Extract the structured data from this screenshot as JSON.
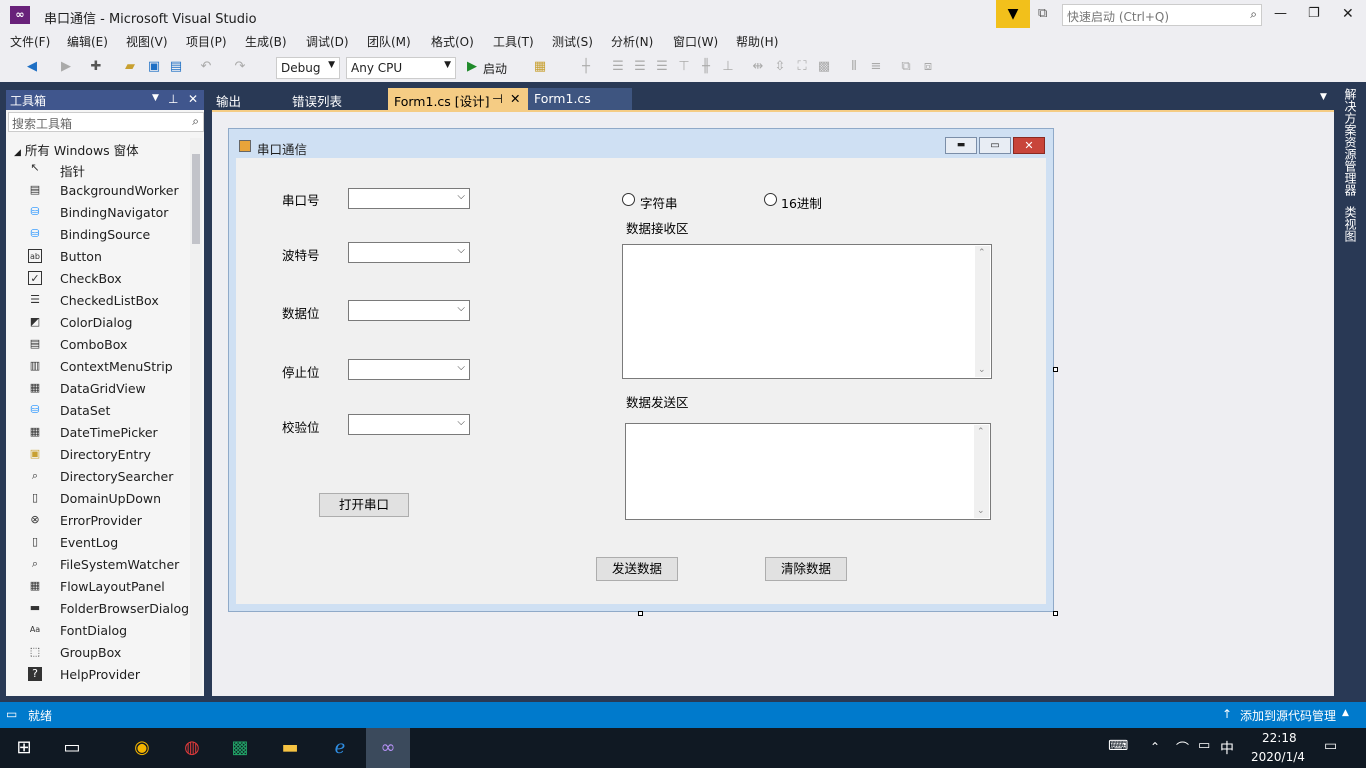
{
  "window": {
    "title": "串口通信 - Microsoft Visual Studio",
    "quick_launch_placeholder": "快速启动 (Ctrl+Q)"
  },
  "menu": [
    "文件(F)",
    "编辑(E)",
    "视图(V)",
    "项目(P)",
    "生成(B)",
    "调试(D)",
    "团队(M)",
    "格式(O)",
    "工具(T)",
    "测试(S)",
    "分析(N)",
    "窗口(W)",
    "帮助(H)"
  ],
  "toolbar": {
    "config": "Debug",
    "platform": "Any CPU",
    "start": "启动"
  },
  "toolbox": {
    "title": "工具箱",
    "search_placeholder": "搜索工具箱",
    "group": "所有 Windows 窗体",
    "items": [
      "指针",
      "BackgroundWorker",
      "BindingNavigator",
      "BindingSource",
      "Button",
      "CheckBox",
      "CheckedListBox",
      "ColorDialog",
      "ComboBox",
      "ContextMenuStrip",
      "DataGridView",
      "DataSet",
      "DateTimePicker",
      "DirectoryEntry",
      "DirectorySearcher",
      "DomainUpDown",
      "ErrorProvider",
      "EventLog",
      "FileSystemWatcher",
      "FlowLayoutPanel",
      "FolderBrowserDialog",
      "FontDialog",
      "GroupBox",
      "HelpProvider"
    ]
  },
  "tabs": [
    "输出",
    "错误列表",
    "Form1.cs [设计]",
    "Form1.cs"
  ],
  "right_rail": [
    "解决方案资源管理器",
    "类视图"
  ],
  "form": {
    "title": "串口通信",
    "labels": {
      "port": "串口号",
      "baud": "波特号",
      "databits": "数据位",
      "stopbits": "停止位",
      "parity": "校验位",
      "recv": "数据接收区",
      "send": "数据发送区"
    },
    "radios": {
      "string": "字符串",
      "hex": "16进制"
    },
    "buttons": {
      "open": "打开串口",
      "send": "发送数据",
      "clear": "清除数据"
    }
  },
  "status": {
    "text": "就绪",
    "source_control": "添加到源代码管理"
  },
  "taskbar": {
    "time": "22:18",
    "date": "2020/1/4",
    "ime": "中"
  }
}
